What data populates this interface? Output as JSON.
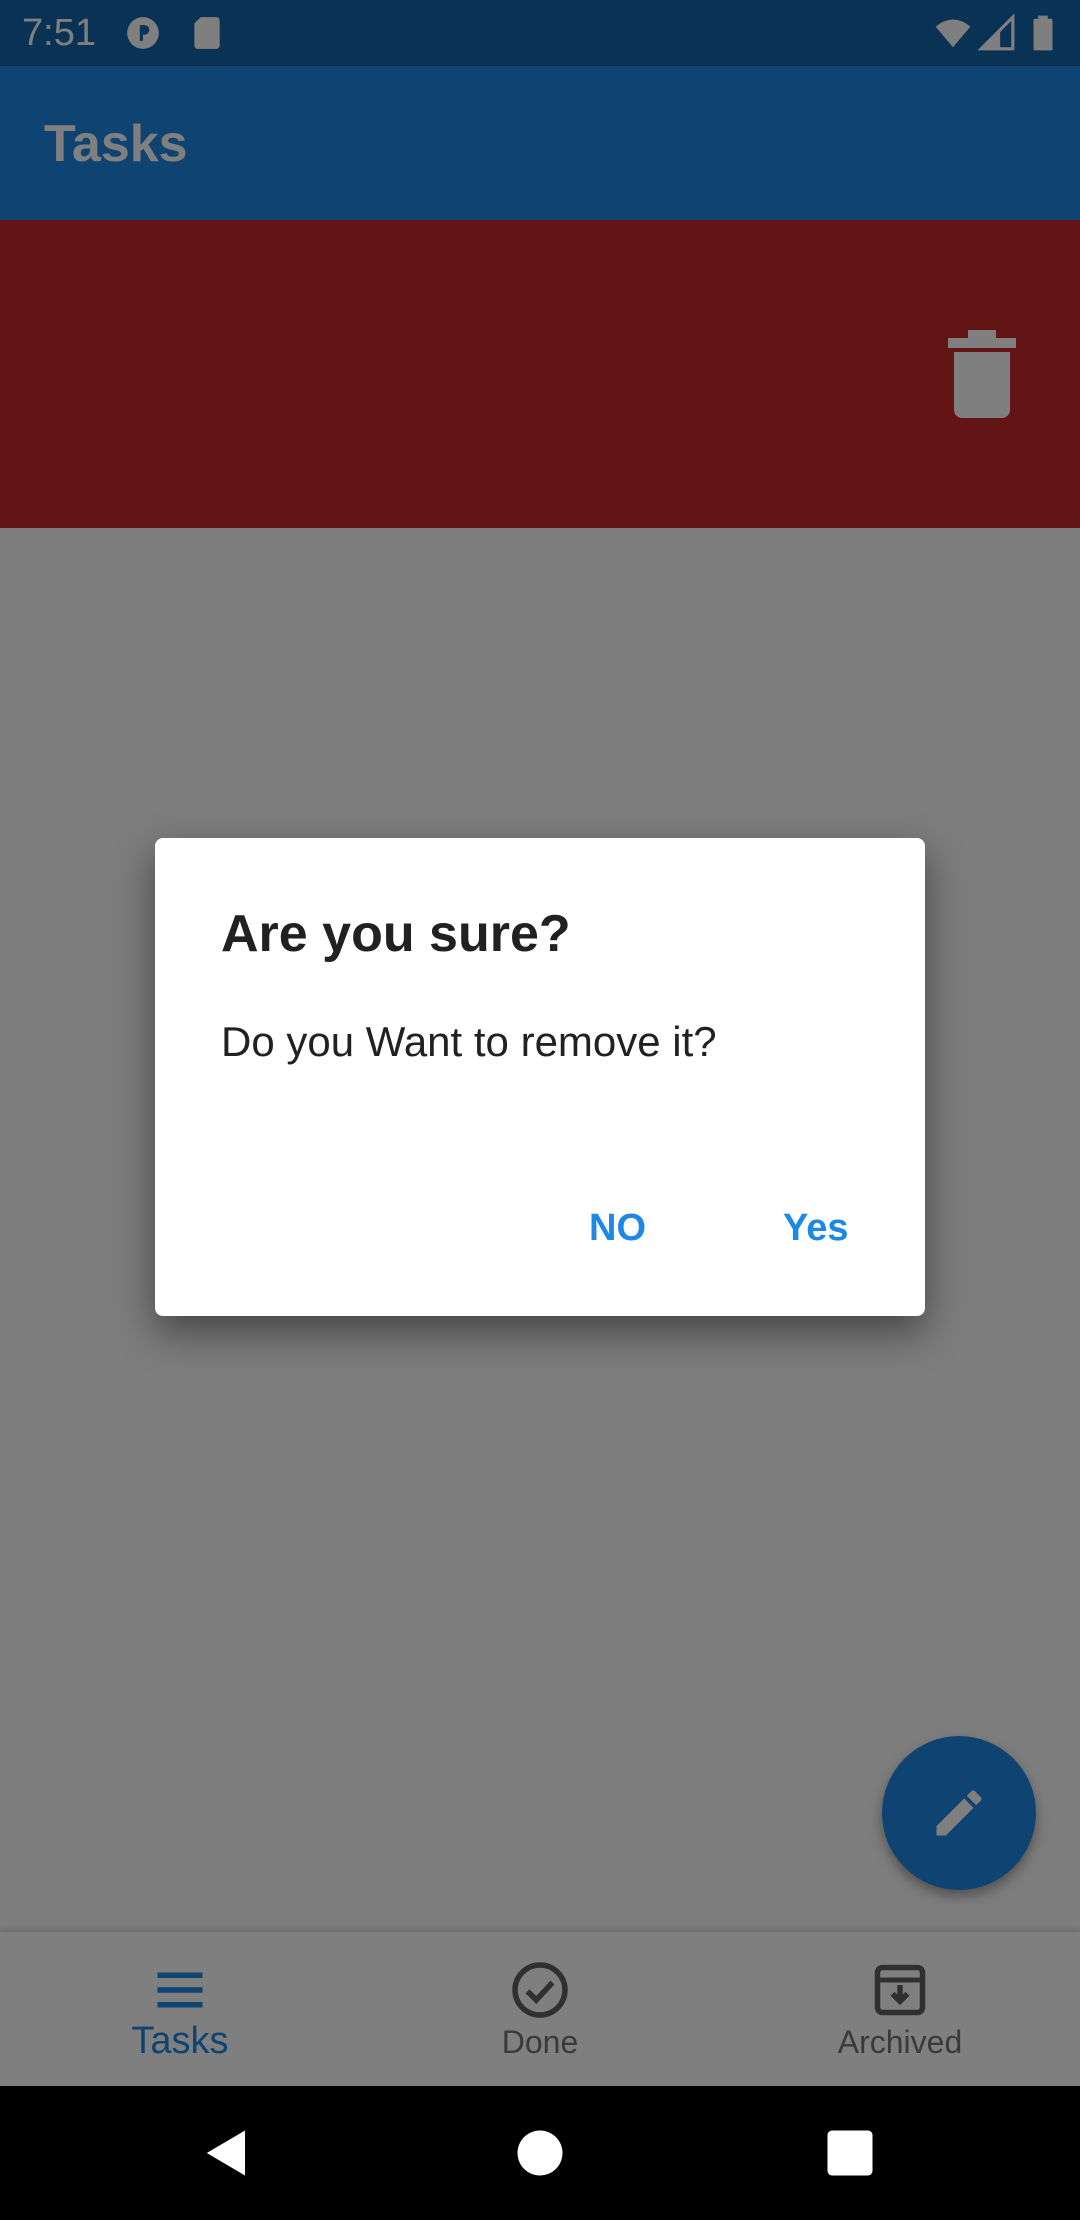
{
  "status_bar": {
    "time": "7:51"
  },
  "app_bar": {
    "title": "Tasks"
  },
  "swipe_background": {
    "color": "#c62828",
    "icon": "delete-icon"
  },
  "dialog": {
    "title": "Are you sure?",
    "message": "Do you Want to remove it?",
    "no_label": "NO",
    "yes_label": "Yes"
  },
  "fab": {
    "icon": "edit-icon"
  },
  "bottom_nav": {
    "items": [
      {
        "label": "Tasks",
        "icon": "menu-icon",
        "active": true
      },
      {
        "label": "Done",
        "icon": "check-circle-icon",
        "active": false
      },
      {
        "label": "Archived",
        "icon": "archive-icon",
        "active": false
      }
    ]
  },
  "colors": {
    "primary": "#1e88e5",
    "danger": "#c62828"
  }
}
